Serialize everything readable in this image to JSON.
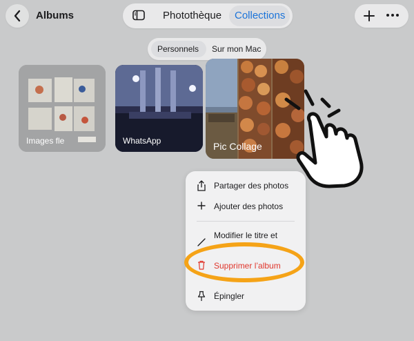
{
  "header": {
    "title": "Albums",
    "segments": [
      "Photothèque",
      "Collections"
    ],
    "active_segment": "Collections"
  },
  "subtabs": [
    "Personnels",
    "Sur mon Mac"
  ],
  "albums": [
    {
      "title": "Images fle"
    },
    {
      "title": "WhatsApp"
    },
    {
      "title": "Pic Collage"
    }
  ],
  "menu": {
    "share": "Partager des photos",
    "add": "Ajouter des photos",
    "edit": "Modifier le titre et",
    "delete": "Supprimer l’album",
    "pin": "Épingler"
  },
  "colors": {
    "accent": "#1a73d9",
    "destructive": "#e0362c",
    "highlight": "#f5a317"
  },
  "icons": [
    "chevron-left-icon",
    "sidebar-icon",
    "plus-icon",
    "more-icon",
    "share-icon",
    "plus-icon",
    "pencil-icon",
    "trash-icon",
    "pin-icon",
    "pointing-hand-icon"
  ]
}
